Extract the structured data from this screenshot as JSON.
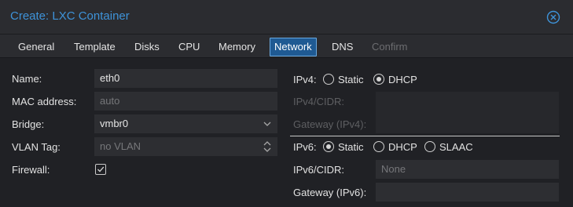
{
  "dialog": {
    "title": "Create: LXC Container"
  },
  "tabs": [
    {
      "label": "General"
    },
    {
      "label": "Template"
    },
    {
      "label": "Disks"
    },
    {
      "label": "CPU"
    },
    {
      "label": "Memory"
    },
    {
      "label": "Network",
      "active": true
    },
    {
      "label": "DNS"
    },
    {
      "label": "Confirm",
      "disabled": true
    }
  ],
  "left": {
    "name": {
      "label": "Name:",
      "value": "eth0"
    },
    "mac": {
      "label": "MAC address:",
      "placeholder": "auto"
    },
    "bridge": {
      "label": "Bridge:",
      "value": "vmbr0"
    },
    "vlan": {
      "label": "VLAN Tag:",
      "placeholder": "no VLAN"
    },
    "firewall": {
      "label": "Firewall:",
      "checked": true
    }
  },
  "ipv4": {
    "label": "IPv4:",
    "options": [
      "Static",
      "DHCP"
    ],
    "selected": "DHCP",
    "cidr_label": "IPv4/CIDR:",
    "gateway_label": "Gateway (IPv4):"
  },
  "ipv6": {
    "label": "IPv6:",
    "options": [
      "Static",
      "DHCP",
      "SLAAC"
    ],
    "selected": "Static",
    "cidr_label": "IPv6/CIDR:",
    "cidr_placeholder": "None",
    "gateway_label": "Gateway (IPv6):"
  },
  "colors": {
    "accent": "#3e93d9",
    "tab_active": "#1f5a93",
    "background": "#202125"
  }
}
